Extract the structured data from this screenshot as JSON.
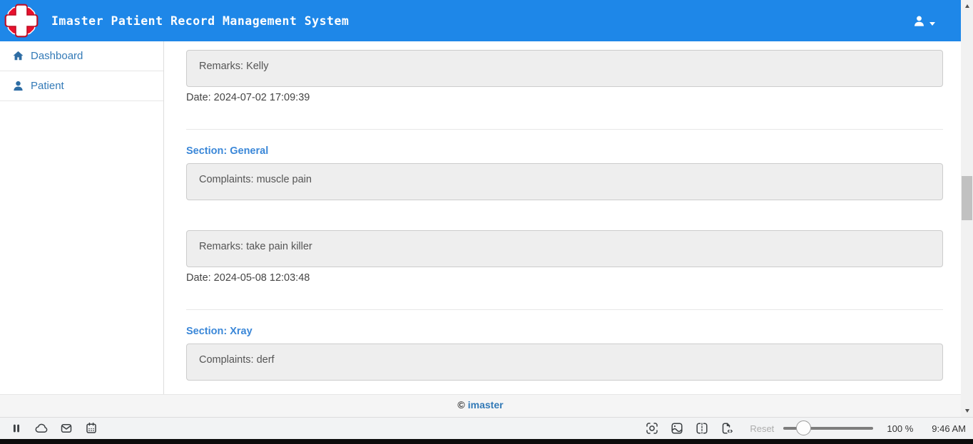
{
  "header": {
    "title": "Imaster Patient Record Management System",
    "logo_icon": "medical-cross-logo",
    "user_icon": "person-icon"
  },
  "sidebar": {
    "items": [
      {
        "label": "Dashboard",
        "icon": "home-icon"
      },
      {
        "label": "Patient",
        "icon": "person-icon"
      }
    ]
  },
  "main": {
    "top_record": {
      "remarks": "Remarks: Kelly",
      "date": "Date: 2024-07-02 17:09:39"
    },
    "sections": [
      {
        "title": "Section: General",
        "complaints": "Complaints: muscle pain",
        "remarks": "Remarks: take pain killer",
        "date": "Date: 2024-05-08 12:03:48"
      },
      {
        "title": "Section: Xray",
        "complaints": "Complaints: derf"
      }
    ]
  },
  "footer": {
    "copyright_symbol": "©",
    "brand": "imaster"
  },
  "taskbar": {
    "left_icons": [
      "pause-icon",
      "cloud-icon",
      "mail-icon",
      "calendar-icon"
    ],
    "right_icons": [
      "screen-capture-icon",
      "image-icon",
      "split-view-icon",
      "code-file-icon"
    ],
    "reset_label": "Reset",
    "zoom_value": "100 %",
    "clock": "9:46 AM"
  },
  "colors": {
    "header_blue": "#1e87e8",
    "link_blue": "#337ab7",
    "section_blue": "#3a87d8",
    "box_bg": "#eeeeee",
    "box_border": "#cccccc",
    "logo_red": "#e8112d"
  }
}
